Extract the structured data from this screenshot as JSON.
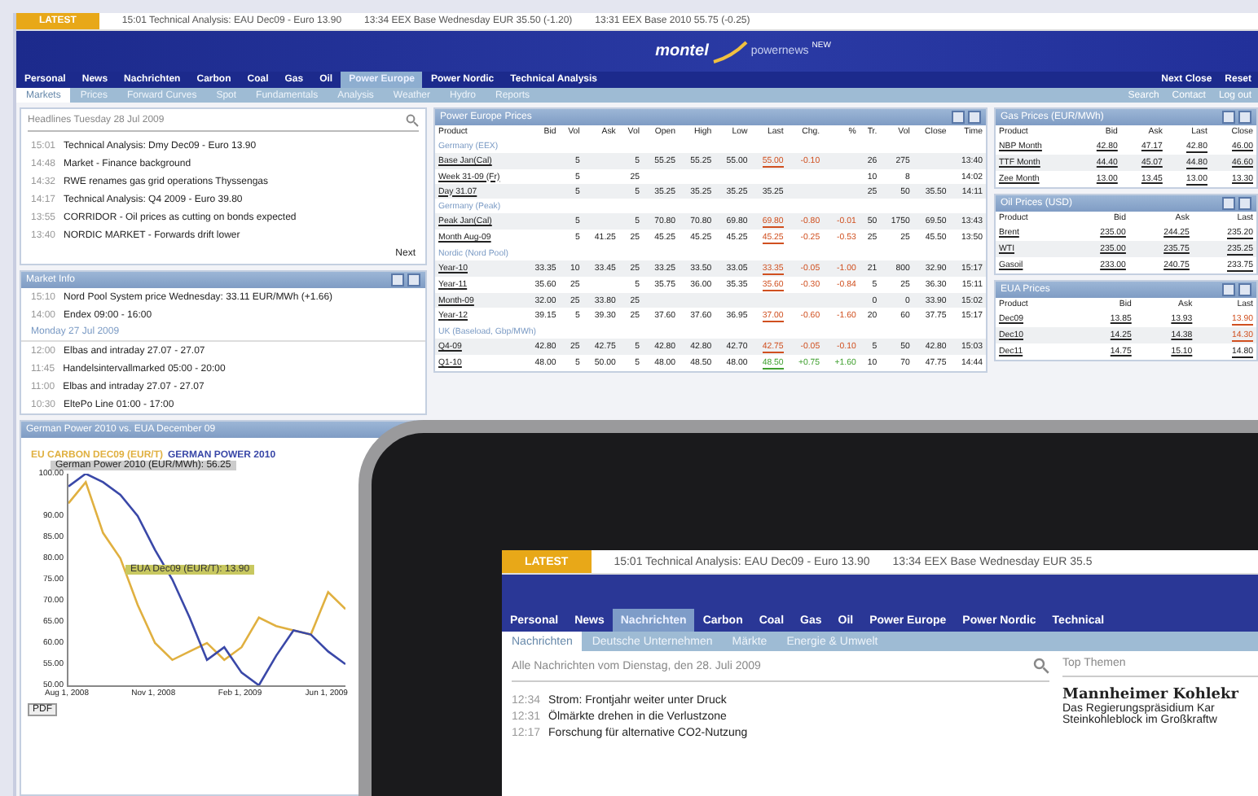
{
  "ticker": {
    "tag": "LATEST",
    "items": [
      "15:01 Technical Analysis: EAU Dec09 - Euro 13.90",
      "13:34 EEX Base Wednesday EUR 35.50 (-1.20)",
      "13:31 EEX Base 2010 55.75 (-0.25)"
    ]
  },
  "header": {
    "logo": "montel",
    "logo_sub": "powernews",
    "logo_tag": "NEW"
  },
  "nav": {
    "tabs": [
      {
        "label": "Personal",
        "selected": false
      },
      {
        "label": "News",
        "selected": false
      },
      {
        "label": "Nachrichten",
        "selected": false
      },
      {
        "label": "Carbon",
        "selected": false
      },
      {
        "label": "Coal",
        "selected": false
      },
      {
        "label": "Gas",
        "selected": false
      },
      {
        "label": "Oil",
        "selected": false
      },
      {
        "label": "Power Europe",
        "selected": true
      },
      {
        "label": "Power Nordic",
        "selected": false
      },
      {
        "label": "Technical Analysis",
        "selected": false
      }
    ],
    "links": [
      "Next Close",
      "Reset"
    ]
  },
  "subnav": {
    "tabs": [
      {
        "label": "Markets",
        "selected": true
      },
      {
        "label": "Prices",
        "selected": false
      },
      {
        "label": "Forward Curves",
        "selected": false
      },
      {
        "label": "Spot",
        "selected": false
      },
      {
        "label": "Fundamentals",
        "selected": false
      },
      {
        "label": "Analysis",
        "selected": false
      },
      {
        "label": "Weather",
        "selected": false
      },
      {
        "label": "Hydro",
        "selected": false
      },
      {
        "label": "Reports",
        "selected": false
      }
    ],
    "links": [
      "Search",
      "Contact",
      "Log out"
    ]
  },
  "headlines": {
    "title": "Headlines Tuesday 28 Jul 2009",
    "more": "Next",
    "items": [
      {
        "time": "15:01",
        "text": "Technical Analysis: Dmy Dec09 - Euro 13.90"
      },
      {
        "time": "14:48",
        "text": "Market - Finance background"
      },
      {
        "time": "14:32",
        "text": "RWE renames gas grid operations Thyssengas"
      },
      {
        "time": "14:17",
        "text": "Technical Analysis: Q4 2009 - Euro 39.80"
      },
      {
        "time": "13:55",
        "text": "CORRIDOR - Oil prices as cutting on bonds expected"
      },
      {
        "time": "13:40",
        "text": "NORDIC MARKET - Forwards drift lower"
      }
    ]
  },
  "market_info": {
    "title": "Market Info",
    "date": "Monday 27 Jul 2009",
    "items": [
      {
        "time": "15:10",
        "text": "Nord Pool System price Wednesday: 33.11 EUR/MWh (+1.66)"
      },
      {
        "time": "14:00",
        "text": "Endex 09:00 - 16:00"
      }
    ],
    "items2": [
      {
        "time": "12:00",
        "text": "Elbas and intraday 27.07 - 27.07"
      },
      {
        "time": "11:45",
        "text": "Handelsintervallmarked 05:00 - 20:00"
      },
      {
        "time": "11:00",
        "text": "Elbas and intraday 27.07 - 27.07"
      },
      {
        "time": "10:30",
        "text": "EltePo Line 01:00 - 17:00"
      }
    ]
  },
  "chart_panel": {
    "title": "German Power 2010 vs. EUA December 09",
    "range_label": "German Power 2010 (EUR/MWh): 56.25",
    "annotation": "EUA Dec09 (EUR/T): 13.90",
    "footer": "PDF",
    "chart_data": {
      "type": "line",
      "categories": [
        "Aug 1, 2008",
        null,
        null,
        null,
        null,
        "Nov 1, 2008",
        null,
        null,
        null,
        null,
        "Feb 1, 2009",
        null,
        null,
        null,
        null,
        "Jun 1, 2009",
        null
      ],
      "ylim": [
        50,
        100
      ],
      "yticks": [
        {
          "value": 100,
          "label": "100.00"
        },
        {
          "value": 90,
          "label": "90.00"
        },
        {
          "value": 85,
          "label": "85.00"
        },
        {
          "value": 80,
          "label": "80.00"
        },
        {
          "value": 75,
          "label": "75.00"
        },
        {
          "value": 70,
          "label": "70.00"
        },
        {
          "value": 65,
          "label": "65.00"
        },
        {
          "value": 60,
          "label": "60.00"
        },
        {
          "value": 55,
          "label": "55.00"
        },
        {
          "value": 50,
          "label": "50.00"
        }
      ],
      "series": [
        {
          "name": "EU CARBON DEC09 (EUR/T)",
          "color": "#e0b040",
          "values": [
            93,
            98,
            86,
            80,
            69,
            60,
            56,
            58,
            60,
            56,
            59,
            66,
            64,
            63,
            62,
            72,
            68
          ]
        },
        {
          "name": "GERMAN POWER 2010",
          "color": "#3a48a8",
          "values": [
            97,
            100,
            98,
            95,
            90,
            82,
            75,
            66,
            56,
            59,
            53,
            50,
            57,
            63,
            62,
            58,
            55
          ]
        }
      ]
    }
  },
  "prices": {
    "title": "Power Europe Prices",
    "columns": [
      "Product",
      "Bid",
      "Vol",
      "Ask",
      "Vol",
      "Open",
      "High",
      "Low",
      "Last",
      "Chg.",
      "%",
      "Tr.",
      "Vol",
      "Close",
      "Time"
    ],
    "groups": [
      {
        "name": "Germany (EEX)",
        "rows": [
          {
            "color": "#d05020",
            "cells": [
              "Base Jan(Cal)",
              "",
              "5",
              "",
              "5",
              "55.25",
              "55.25",
              "55.00",
              "55.00",
              "-0.10",
              "",
              "26",
              "275",
              "",
              "13:40"
            ]
          },
          {
            "cells": [
              "Week 31-09 (Fr)",
              "",
              "5",
              "",
              "25",
              "",
              "",
              "",
              "",
              "",
              "",
              "10",
              "8",
              "",
              "14:02"
            ]
          },
          {
            "cells": [
              "Day 31.07",
              "",
              "5",
              "",
              "5",
              "35.25",
              "35.25",
              "35.25",
              "35.25",
              "",
              "",
              "25",
              "50",
              "35.50",
              "14:11"
            ]
          }
        ]
      },
      {
        "name": "Germany (Peak)",
        "rows": [
          {
            "color": "#d05020",
            "cells": [
              "Peak Jan(Cal)",
              "",
              "5",
              "",
              "5",
              "70.80",
              "70.80",
              "69.80",
              "69.80",
              "-0.80",
              "-0.01",
              "50",
              "1750",
              "69.50",
              "13:43"
            ]
          },
          {
            "color": "#d05020",
            "cells": [
              "Month Aug-09",
              "",
              "5",
              "41.25",
              "25",
              "45.25",
              "45.25",
              "45.25",
              "45.25",
              "-0.25",
              "-0.53",
              "25",
              "25",
              "45.50",
              "13:50"
            ]
          }
        ]
      },
      {
        "name": "Nordic (Nord Pool)",
        "rows": [
          {
            "color": "#d05020",
            "cells": [
              "Year-10",
              "33.35",
              "10",
              "33.45",
              "25",
              "33.25",
              "33.50",
              "33.05",
              "33.35",
              "-0.05",
              "-1.00",
              "21",
              "800",
              "32.90",
              "15:17"
            ]
          },
          {
            "color": "#d05020",
            "cells": [
              "Year-11",
              "35.60",
              "25",
              "",
              "5",
              "35.75",
              "36.00",
              "35.35",
              "35.60",
              "-0.30",
              "-0.84",
              "5",
              "25",
              "36.30",
              "15:11"
            ]
          },
          {
            "cells": [
              "Month-09",
              "32.00",
              "25",
              "33.80",
              "25",
              "",
              "",
              "",
              "",
              "",
              "",
              "0",
              "0",
              "33.90",
              "15:02"
            ]
          },
          {
            "color": "#d05020",
            "cells": [
              "Year-12",
              "39.15",
              "5",
              "39.30",
              "25",
              "37.60",
              "37.60",
              "36.95",
              "37.00",
              "-0.60",
              "-1.60",
              "20",
              "60",
              "37.75",
              "15:17"
            ]
          }
        ]
      },
      {
        "name": "UK (Baseload, Gbp/MWh)",
        "rows": [
          {
            "color": "#d05020",
            "cells": [
              "Q4-09",
              "42.80",
              "25",
              "42.75",
              "5",
              "42.80",
              "42.80",
              "42.70",
              "42.75",
              "-0.05",
              "-0.10",
              "5",
              "50",
              "42.80",
              "15:03"
            ]
          },
          {
            "color": "#40a030",
            "cells": [
              "Q1-10",
              "48.00",
              "5",
              "50.00",
              "5",
              "48.00",
              "48.50",
              "48.00",
              "48.50",
              "+0.75",
              "+1.60",
              "10",
              "70",
              "47.75",
              "14:44"
            ]
          }
        ]
      }
    ]
  },
  "side_tables": [
    {
      "title": "Gas Prices (EUR/MWh)",
      "columns": [
        "Product",
        "Bid",
        "Ask",
        "Last",
        "Close"
      ],
      "rows": [
        {
          "color": "#222222",
          "cells": [
            "NBP Month",
            "42.80",
            "47.17",
            "42.80",
            "46.00"
          ]
        },
        {
          "color": "#222222",
          "cells": [
            "TTF Month",
            "44.40",
            "45.07",
            "44.80",
            "46.60"
          ]
        },
        {
          "color": "#222222",
          "cells": [
            "Zee Month",
            "13.00",
            "13.45",
            "13.00",
            "13.30"
          ]
        }
      ]
    },
    {
      "title": "Oil Prices (USD)",
      "columns": [
        "Product",
        "Bid",
        "Ask",
        "Last"
      ],
      "rows": [
        {
          "color": "#222222",
          "cells": [
            "Brent",
            "235.00",
            "244.25",
            "235.20"
          ]
        },
        {
          "color": "#222222",
          "cells": [
            "WTI",
            "235.00",
            "235.75",
            "235.25"
          ]
        },
        {
          "color": "#222222",
          "cells": [
            "Gasoil",
            "233.00",
            "240.75",
            "233.75"
          ]
        }
      ]
    },
    {
      "title": "EUA Prices",
      "columns": [
        "Product",
        "Bid",
        "Ask",
        "Last"
      ],
      "rows": [
        {
          "color": "#d05020",
          "cells": [
            "Dec09",
            "13.85",
            "13.93",
            "13.90"
          ]
        },
        {
          "color": "#d05020",
          "cells": [
            "Dec10",
            "14.25",
            "14.38",
            "14.30"
          ]
        },
        {
          "color": "#222222",
          "cells": [
            "Dec11",
            "14.75",
            "15.10",
            "14.80"
          ]
        }
      ]
    }
  ],
  "tablet": {
    "ticker": {
      "tag": "LATEST",
      "items": [
        "15:01 Technical Analysis: EAU Dec09 - Euro 13.90",
        "13:34 EEX Base Wednesday EUR 35.5"
      ]
    },
    "tabs": [
      {
        "label": "Personal",
        "selected": false
      },
      {
        "label": "News",
        "selected": false
      },
      {
        "label": "Nachrichten",
        "selected": true
      },
      {
        "label": "Carbon",
        "selected": false
      },
      {
        "label": "Coal",
        "selected": false
      },
      {
        "label": "Gas",
        "selected": false
      },
      {
        "label": "Oil",
        "selected": false
      },
      {
        "label": "Power Europe",
        "selected": false
      },
      {
        "label": "Power Nordic",
        "selected": false
      },
      {
        "label": "Technical",
        "selected": false
      }
    ],
    "subtabs": [
      {
        "label": "Nachrichten",
        "selected": true
      },
      {
        "label": "Deutsche Unternehmen",
        "selected": false
      },
      {
        "label": "Märkte",
        "selected": false
      },
      {
        "label": "Energie & Umwelt",
        "selected": false
      }
    ],
    "list_title": "Alle Nachrichten vom Dienstag, den 28. Juli 2009",
    "side_title": "Top Themen",
    "items": [
      {
        "time": "12:34",
        "text": "Strom: Frontjahr weiter unter Druck"
      },
      {
        "time": "12:31",
        "text": "Ölmärkte drehen in die Verlustzone"
      },
      {
        "time": "12:17",
        "text": "Forschung für alternative CO2-Nutzung"
      }
    ],
    "headline": "Mannheimer Kohlekr",
    "body": [
      "Das Regierungspräsidium Kar",
      "Steinkohleblock im Großkraftw"
    ]
  }
}
